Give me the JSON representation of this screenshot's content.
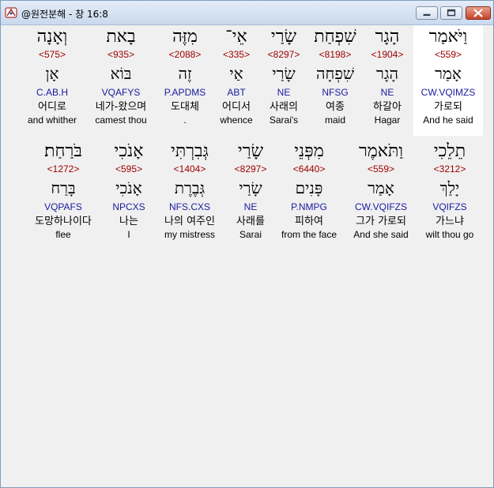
{
  "window": {
    "title": "@원전분해 - 창 16:8",
    "app_icon": "hebrew-app-icon"
  },
  "rows": [
    {
      "words": [
        {
          "heb": "וַיֹּאמַר",
          "strong": "<559>",
          "lemma": "אָמַר",
          "parse": "CW.VQIMZS",
          "kor": "가로되",
          "eng": "And he said",
          "highlight": true
        },
        {
          "heb": "הָגָר",
          "strong": "<1904>",
          "lemma": "הָגָר",
          "parse": "NE",
          "kor": "하갈아",
          "eng": "Hagar"
        },
        {
          "heb": "שִׁפְחַת",
          "strong": "<8198>",
          "lemma": "שִׁפְחָה",
          "parse": "NFSG",
          "kor": "여종",
          "eng": "maid"
        },
        {
          "heb": "שָׂרַי",
          "strong": "<8297>",
          "lemma": "שָׂרַי",
          "parse": "NE",
          "kor": "사래의",
          "eng": "Sarai's"
        },
        {
          "heb": "אֵי־",
          "strong": "<335>",
          "lemma": "אַי",
          "parse": "ABT",
          "kor": "어디서",
          "eng": "whence"
        },
        {
          "heb": "מִזֶּה",
          "strong": "<2088>",
          "lemma": "זֶה",
          "parse": "P.APDMS",
          "kor": "도대체",
          "eng": "."
        },
        {
          "heb": "בָאת",
          "strong": "<935>",
          "lemma": "בּוֹא",
          "parse": "VQAFYS",
          "kor": "네가-왔으며",
          "eng": "camest thou"
        },
        {
          "heb": "וְאָנָה",
          "strong": "<575>",
          "lemma": "אָן",
          "parse": "C.AB.H",
          "kor": "어디로",
          "eng": "and whither"
        }
      ]
    },
    {
      "words": [
        {
          "heb": "תֵלֵכִי",
          "strong": "<3212>",
          "lemma": "יָלַךְ",
          "parse": "VQIFZS",
          "kor": "가느냐",
          "eng": "wilt thou go"
        },
        {
          "heb": "וַתֹּאמֶר",
          "strong": "<559>",
          "lemma": "אָמַר",
          "parse": "CW.VQIFZS",
          "kor": "그가 가로되",
          "eng": "And she said"
        },
        {
          "heb": "מִפְּנֵי",
          "strong": "<6440>",
          "lemma": "פָּנִים",
          "parse": "P.NMPG",
          "kor": "피하여",
          "eng": "from the face"
        },
        {
          "heb": "שָׂרַי",
          "strong": "<8297>",
          "lemma": "שָׂרַי",
          "parse": "NE",
          "kor": "사래를",
          "eng": "Sarai"
        },
        {
          "heb": "גְּבִרְתִּי",
          "strong": "<1404>",
          "lemma": "גְּבֶרֶת",
          "parse": "NFS.CXS",
          "kor": "나의 여주인",
          "eng": "my mistress"
        },
        {
          "heb": "אָנֹכִי",
          "strong": "<595>",
          "lemma": "אָנֹכִי",
          "parse": "NPCXS",
          "kor": "나는",
          "eng": "I"
        },
        {
          "heb": "בֹּרַחַת׃",
          "strong": "<1272>",
          "lemma": "בָּרַח",
          "parse": "VQPAFS",
          "kor": "도망하나이다",
          "eng": "flee"
        }
      ]
    }
  ]
}
